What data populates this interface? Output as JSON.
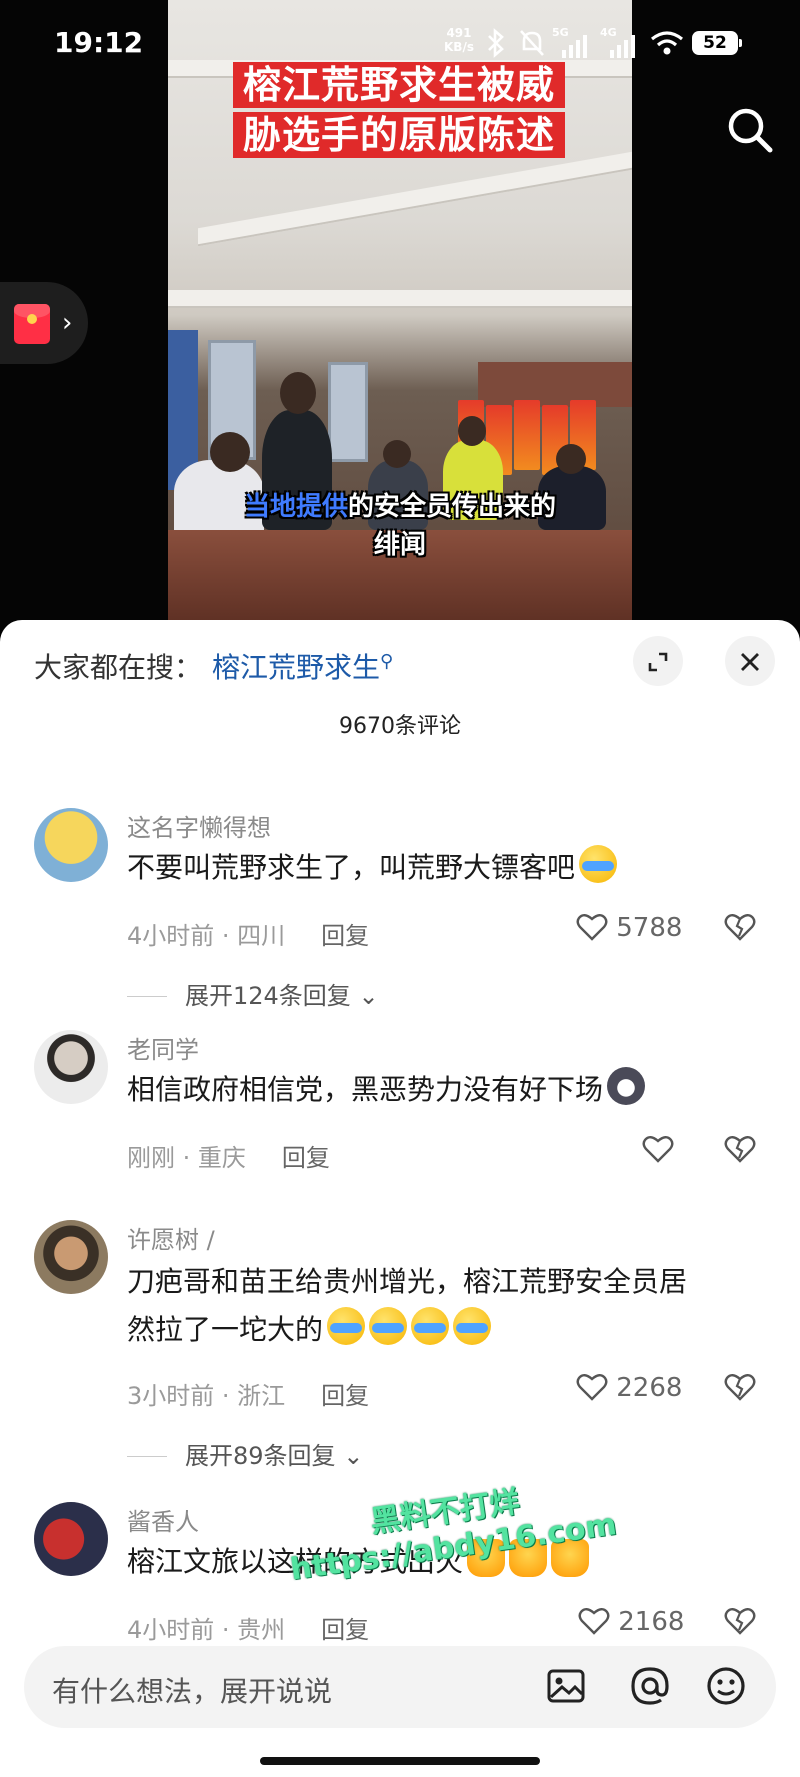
{
  "status_bar": {
    "time": "19:12",
    "net_speed_value": "491",
    "net_speed_unit": "KB/s",
    "signal_1": "5G",
    "signal_2": "4G",
    "battery": "52"
  },
  "video": {
    "title_line_1": "榕江荒野求生被威",
    "title_line_2": "胁选手的原版陈述",
    "subtitle_highlight": "当地提供",
    "subtitle_rest": "的安全员传出来的",
    "subtitle_line_2": "绯闻"
  },
  "sheet": {
    "hot_search_label": "大家都在搜：",
    "hot_search_keyword": "榕江荒野求生",
    "comment_count": "9670条评论"
  },
  "comments": [
    {
      "user": "这名字懒得想",
      "text": "不要叫荒野求生了，叫荒野大镖客吧",
      "time": "4小时前",
      "location": "四川",
      "reply": "回复",
      "likes": "5788",
      "expand": "展开124条回复"
    },
    {
      "user": "老同学",
      "text": "相信政府相信党，黑恶势力没有好下场",
      "time": "刚刚",
      "location": "重庆",
      "reply": "回复",
      "likes": ""
    },
    {
      "user": "许愿树",
      "text_1": "刀疤哥和苗王给贵州增光，榕江荒野安全员居",
      "text_2": "然拉了一坨大的",
      "time": "3小时前",
      "location": "浙江",
      "reply": "回复",
      "likes": "2268",
      "expand": "展开89条回复"
    },
    {
      "user": "酱香人",
      "text": "榕江文旅以这样的方式",
      "text_tail": "出火",
      "time": "4小时前",
      "location": "贵州",
      "reply": "回复",
      "likes": "2168"
    }
  ],
  "watermark": {
    "line_1": "黑料不打烊",
    "line_2": "https://abdy16.com"
  },
  "input": {
    "placeholder": "有什么想法，展开说说"
  },
  "icons": [
    "search-icon",
    "red-packet-icon",
    "expand-icon",
    "close-icon",
    "heart-icon",
    "broken-heart-icon",
    "image-icon",
    "at-icon",
    "emoji-icon"
  ],
  "colors": {
    "title_bg": "#e02a2a",
    "keyword": "#1d5aa8",
    "subtitle_highlight": "#3f7bff",
    "watermark": "#53e3a0"
  }
}
